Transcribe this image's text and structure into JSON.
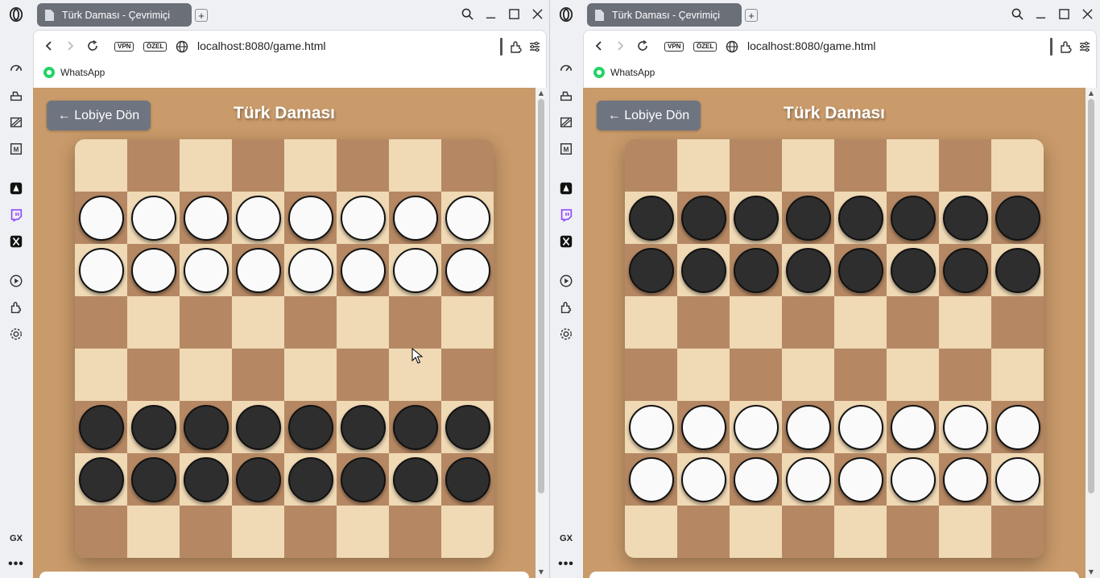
{
  "browser": {
    "tab_title": "Türk Daması - Çevrimiçi",
    "new_tab_label": "+",
    "url": "localhost:8080/game.html",
    "vpn_label": "VPN",
    "private_label": "ÖZEL",
    "bookmark_label": "WhatsApp",
    "sidebar_gx_label": "GX",
    "sidebar_more_label": "•••"
  },
  "game": {
    "back_button_label": "← Lobiye Dön",
    "title": "Türk Daması"
  },
  "colors": {
    "page_background": "#c99a6a",
    "light_square": "#f0d9b5",
    "dark_square": "#b58863",
    "white_piece": "#fafafa",
    "black_piece": "#2e2e2e",
    "back_button": "#6e7580"
  },
  "windows": [
    {
      "orientation": "white-on-top",
      "board": [
        "........",
        "WWWWWWWW",
        "WWWWWWWW",
        "........",
        "........",
        "BBBBBBBB",
        "BBBBBBBB",
        "........"
      ],
      "first_square_light": true
    },
    {
      "orientation": "black-on-top",
      "board": [
        "........",
        "BBBBBBBB",
        "BBBBBBBB",
        "........",
        "........",
        "WWWWWWWW",
        "WWWWWWWW",
        "........"
      ],
      "first_square_light": false
    }
  ]
}
